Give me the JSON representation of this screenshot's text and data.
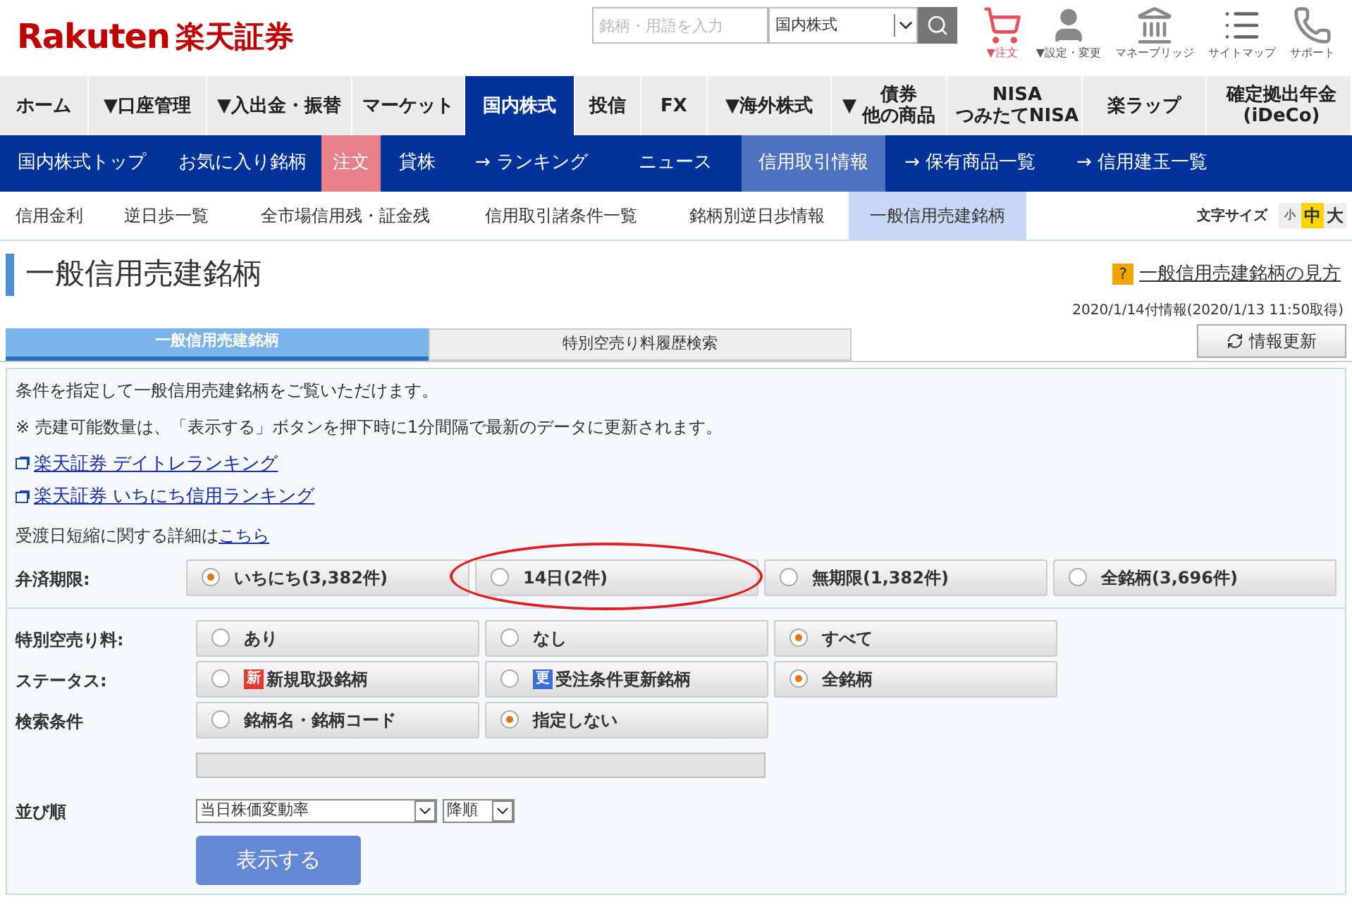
{
  "logo": {
    "brand": "Rakuten",
    "name": "楽天証券"
  },
  "search": {
    "placeholder": "銘柄・用語を入力",
    "market": "国内株式"
  },
  "header_links": [
    {
      "kind": "cart",
      "label": "▼注文"
    },
    {
      "kind": "user",
      "label": "▼設定・変更"
    },
    {
      "kind": "bank",
      "label": "マネーブリッジ"
    },
    {
      "kind": "sitemap",
      "label": "サイトマップ"
    },
    {
      "kind": "phone",
      "label": "サポート"
    }
  ],
  "main_nav": [
    {
      "label": "ホーム",
      "selected": false
    },
    {
      "label": "▼口座管理",
      "selected": false
    },
    {
      "label": "▼入出金・振替",
      "selected": false
    },
    {
      "label": "マーケット",
      "selected": false
    },
    {
      "label": "国内株式",
      "selected": true
    },
    {
      "label": "投信",
      "selected": false
    },
    {
      "label": "FX",
      "selected": false
    },
    {
      "label": "▼海外株式",
      "selected": false
    },
    {
      "label": "▼",
      "lines": [
        "債券",
        "他の商品"
      ],
      "selected": false
    },
    {
      "lines": [
        "NISA",
        "つみたてNISA"
      ],
      "selected": false
    },
    {
      "label": "楽ラップ",
      "selected": false
    },
    {
      "lines": [
        "確定拠出年金",
        "(iDeCo)"
      ],
      "selected": false
    }
  ],
  "sub_nav": [
    {
      "label": "国内株式トップ",
      "kind": "plain",
      "selected": false
    },
    {
      "label": "お気に入り銘柄",
      "kind": "plain",
      "selected": false
    },
    {
      "label": "注文",
      "kind": "order",
      "selected": false
    },
    {
      "label": "貸株",
      "kind": "plain",
      "selected": false
    },
    {
      "label": "→ ランキング",
      "kind": "plain",
      "selected": false
    },
    {
      "label": "ニュース",
      "kind": "plain",
      "selected": false
    },
    {
      "label": "信用取引情報",
      "kind": "plain",
      "selected": true
    },
    {
      "label": "→ 保有商品一覧",
      "kind": "plain",
      "selected": false
    },
    {
      "label": "→ 信用建玉一覧",
      "kind": "plain",
      "selected": false
    }
  ],
  "sub_nav2": [
    {
      "label": "信用金利",
      "selected": false
    },
    {
      "label": "逆日歩一覧",
      "selected": false
    },
    {
      "label": "全市場信用残・証金残",
      "selected": false
    },
    {
      "label": "信用取引諸条件一覧",
      "selected": false
    },
    {
      "label": "銘柄別逆日歩情報",
      "selected": false
    },
    {
      "label": "一般信用売建銘柄",
      "selected": true
    }
  ],
  "font_size": {
    "label": "文字サイズ",
    "options": [
      {
        "label": "小",
        "selected": false
      },
      {
        "label": "中",
        "selected": true
      },
      {
        "label": "大",
        "selected": false
      }
    ]
  },
  "page_title": "一般信用売建銘柄",
  "help_link": {
    "icon": "?",
    "label": "一般信用売建銘柄の見方"
  },
  "updated": "2020/1/14付情報(2020/1/13 11:50取得)",
  "tabs": [
    {
      "label": "一般信用売建銘柄",
      "selected": true
    },
    {
      "label": "特別空売り料履歴検索",
      "selected": false
    }
  ],
  "refresh_button": "情報更新",
  "intro": [
    "条件を指定して一般信用売建銘柄をご覧いただけます。",
    "※  売建可能数量は、「表示する」ボタンを押下時に1分間隔で最新のデータに更新されます。"
  ],
  "links": [
    "楽天証券  デイトレランキング",
    "楽天証券  いちにち信用ランキング"
  ],
  "detail_note": {
    "text": "受渡日短縮に関する詳細は",
    "link": "こちら"
  },
  "filters": [
    {
      "label": "弁済期限:",
      "options": [
        {
          "label": "いちにち(3,382件)",
          "selected": true,
          "circled": false
        },
        {
          "label": "14日(2件)",
          "selected": false,
          "circled": true
        },
        {
          "label": "無期限(1,382件)",
          "selected": false,
          "circled": false
        },
        {
          "label": "全銘柄(3,696件)",
          "selected": false,
          "circled": false
        }
      ]
    },
    {
      "label": "特別空売り料:",
      "options": [
        {
          "label": "あり",
          "selected": false,
          "circled": false
        },
        {
          "label": "なし",
          "selected": false,
          "circled": false
        },
        {
          "label": "すべて",
          "selected": true,
          "circled": false
        }
      ]
    },
    {
      "label": "ステータス:",
      "options": [
        {
          "label": "新規取扱銘柄",
          "selected": false,
          "circled": false,
          "badge": {
            "text": "新",
            "color": "#e53935"
          }
        },
        {
          "label": "受注条件更新銘柄",
          "selected": false,
          "circled": false,
          "badge": {
            "text": "更",
            "color": "#3b6fd6"
          }
        },
        {
          "label": "全銘柄",
          "selected": true,
          "circled": false
        }
      ]
    },
    {
      "label": "検索条件",
      "options": [
        {
          "label": "銘柄名・銘柄コード",
          "selected": false,
          "circled": false
        },
        {
          "label": "指定しない",
          "selected": true,
          "circled": false
        }
      ]
    }
  ],
  "search_input": {
    "disabled": true
  },
  "sort": {
    "label": "並び順",
    "field": "当日株価変動率",
    "order": "降順"
  },
  "submit_button": "表示する"
}
